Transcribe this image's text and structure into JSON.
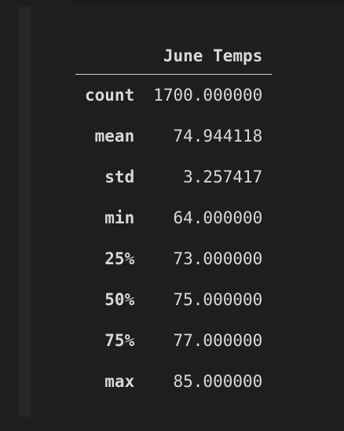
{
  "table": {
    "column_header": "June Temps",
    "rows": [
      {
        "label": "count",
        "value": "1700.000000"
      },
      {
        "label": "mean",
        "value": "74.944118"
      },
      {
        "label": "std",
        "value": "3.257417"
      },
      {
        "label": "min",
        "value": "64.000000"
      },
      {
        "label": "25%",
        "value": "73.000000"
      },
      {
        "label": "50%",
        "value": "75.000000"
      },
      {
        "label": "75%",
        "value": "77.000000"
      },
      {
        "label": "max",
        "value": "85.000000"
      }
    ]
  }
}
